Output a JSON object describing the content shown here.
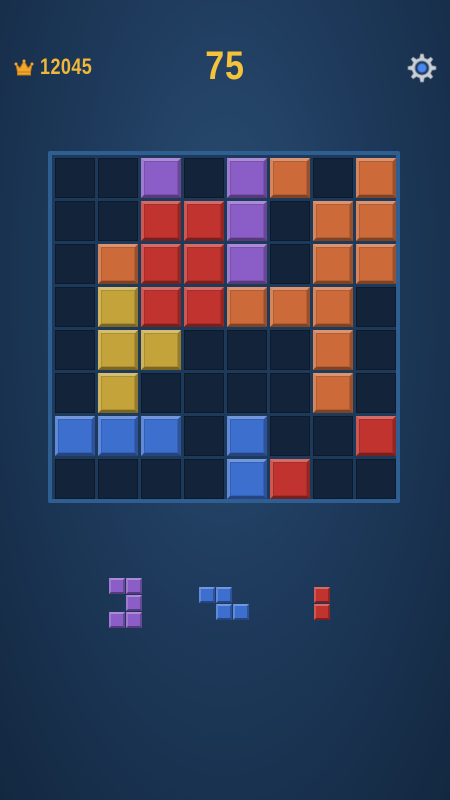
{
  "header": {
    "best_score": "12045",
    "score": "75",
    "best_icon": "crown-icon",
    "settings_icon": "gear-icon"
  },
  "colors": {
    "purple": "#8a5ec6",
    "red": "#c1332f",
    "orange": "#cc6a3a",
    "yellow": "#c4a33a",
    "blue": "#3d6fcf",
    "empty": "#13243a",
    "score": "#f4c23b",
    "best": "#f0b73a"
  },
  "board": {
    "rows": 8,
    "cols": 8,
    "cells": [
      [
        null,
        null,
        "purple",
        null,
        "purple",
        "orange",
        null,
        "orange"
      ],
      [
        null,
        null,
        "red",
        "red",
        "purple",
        null,
        "orange",
        "orange"
      ],
      [
        null,
        "orange",
        "red",
        "red",
        "purple",
        null,
        "orange",
        "orange"
      ],
      [
        null,
        "yellow",
        "red",
        "red",
        "orange",
        "orange",
        "orange",
        null
      ],
      [
        null,
        "yellow",
        "yellow",
        null,
        null,
        null,
        "orange",
        null
      ],
      [
        null,
        "yellow",
        null,
        null,
        null,
        null,
        "orange",
        null
      ],
      [
        "blue",
        "blue",
        "blue",
        null,
        "blue",
        null,
        null,
        "red"
      ],
      [
        null,
        null,
        null,
        null,
        "blue",
        "red",
        null,
        null
      ]
    ]
  },
  "tray": {
    "pieces": [
      {
        "name": "piece-purple-c",
        "color": "purple",
        "cells": [
          [
            0,
            0
          ],
          [
            0,
            1
          ],
          [
            1,
            1
          ],
          [
            2,
            0
          ],
          [
            2,
            1
          ]
        ]
      },
      {
        "name": "piece-blue-z",
        "color": "blue",
        "cells": [
          [
            0,
            0
          ],
          [
            0,
            1
          ],
          [
            1,
            1
          ],
          [
            1,
            2
          ]
        ]
      },
      {
        "name": "piece-red-bar",
        "color": "red",
        "cells": [
          [
            0,
            0
          ],
          [
            1,
            0
          ]
        ]
      }
    ]
  }
}
